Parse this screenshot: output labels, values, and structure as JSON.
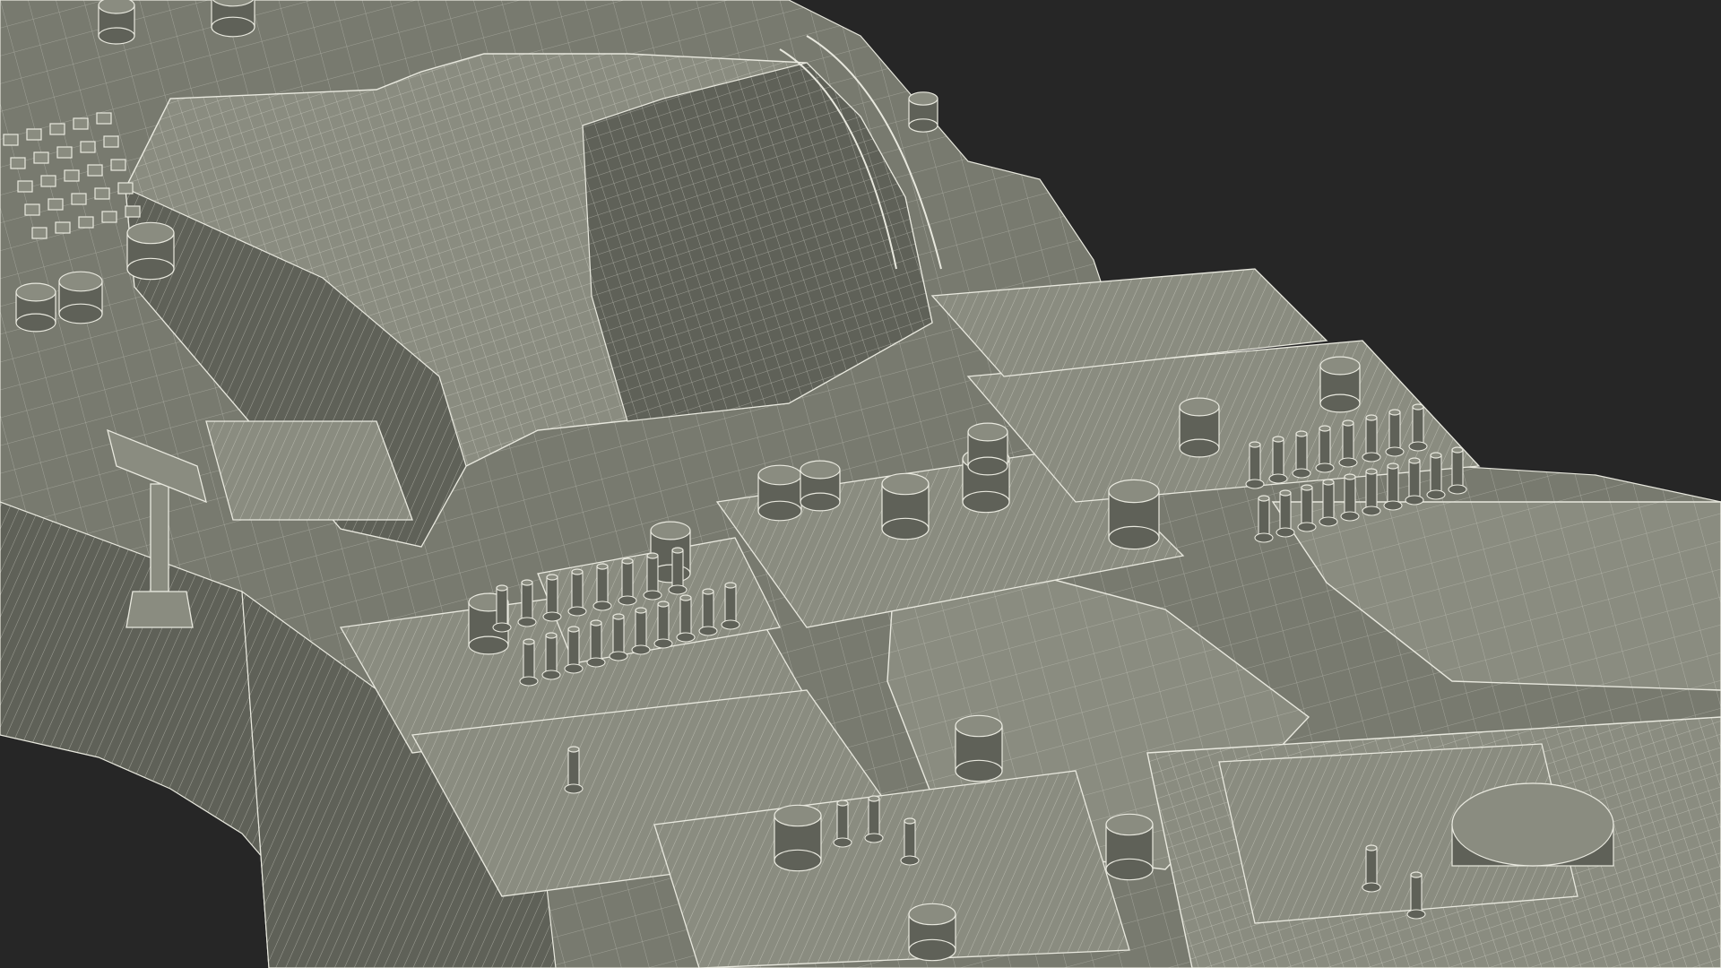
{
  "scene": {
    "subject": "wireframe-render-cockpit-console",
    "colors": {
      "background": "#262626",
      "surface": "#787a6f",
      "surface_light": "#8a8c80",
      "surface_dark": "#5f6158",
      "wire": "#e8e8de"
    }
  }
}
